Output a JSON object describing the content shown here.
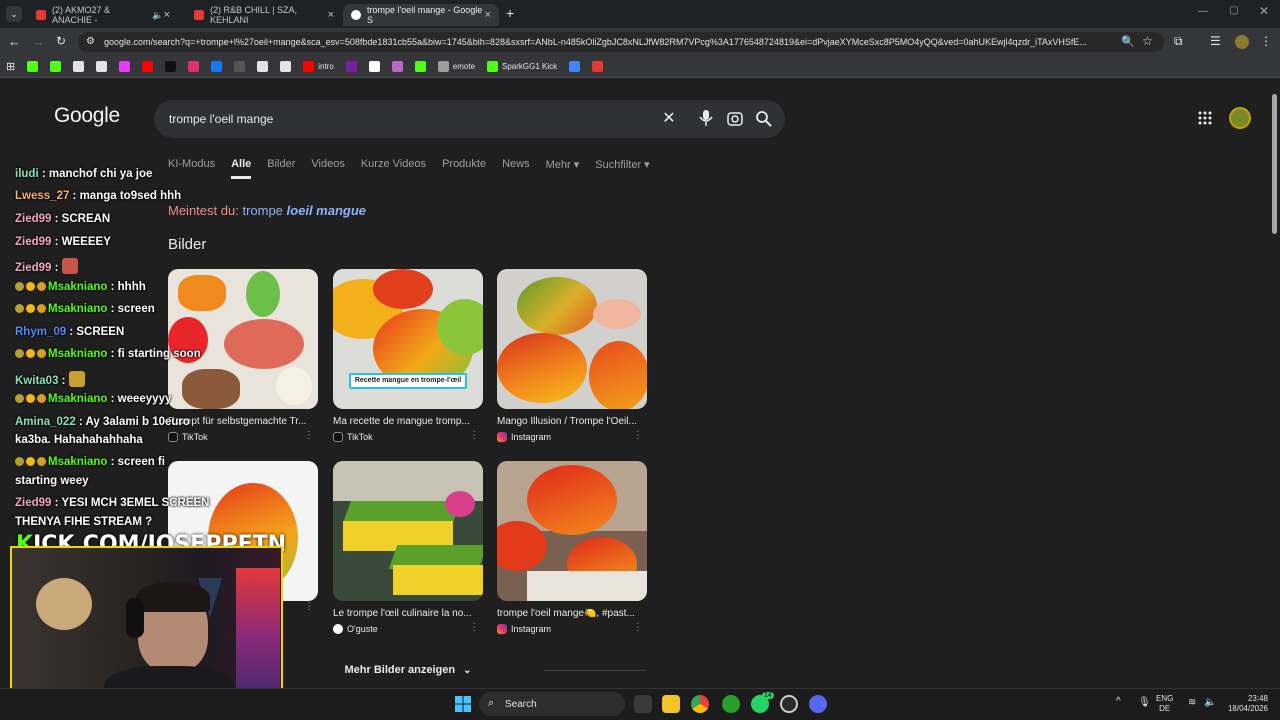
{
  "browser": {
    "tabs": [
      {
        "title": "(2) AKMO27 & ANACHIE - ",
        "active": false,
        "color": "#e53935"
      },
      {
        "title": "(2) R&B CHILL | SZA, KEHLANI",
        "active": false,
        "color": "#e53935"
      },
      {
        "title": "trompe l'oeil mange - Google S",
        "active": true,
        "color": "#8ab4f8"
      }
    ],
    "new_tab": "+",
    "url": "google.com/search?q=+trompe+l%27oeil+mange&sca_esv=508fbde1831cb55a&biw=1745&bih=828&sxsrf=ANbL-n485kOliZgbJC8xNLJfW82RM7VPcg%3A1776548724819&ei=dPvjaeXYMceSxc8P5MO4yQQ&ved=0ahUKEwjl4qzdr_iTAxVHSfE...",
    "bookmarks": [
      {
        "label": "",
        "color": "#53fc18"
      },
      {
        "label": "",
        "color": "#53fc18"
      },
      {
        "label": "",
        "color": "#e3e3e3"
      },
      {
        "label": "",
        "color": "#e3e3e3"
      },
      {
        "label": "",
        "color": "#e040fb"
      },
      {
        "label": "",
        "color": "#ff0000"
      },
      {
        "label": "",
        "color": "#111111"
      },
      {
        "label": "",
        "color": "#e1306c"
      },
      {
        "label": "",
        "color": "#1877f2"
      },
      {
        "label": "",
        "color": "#555555"
      },
      {
        "label": "",
        "color": "#e3e3e3"
      },
      {
        "label": "",
        "color": "#e3e3e3"
      },
      {
        "label": "intro",
        "color": "#ff0000"
      },
      {
        "label": "",
        "color": "#7b1fa2"
      },
      {
        "label": "",
        "color": "#ffffff"
      },
      {
        "label": "",
        "color": "#ba68c8"
      },
      {
        "label": "",
        "color": "#53fc18"
      },
      {
        "label": "emote",
        "color": "#9e9e9e"
      },
      {
        "label": "SparkGG1 Kick",
        "color": "#53fc18"
      },
      {
        "label": "",
        "color": "#4285f4"
      },
      {
        "label": "",
        "color": "#e53935"
      }
    ]
  },
  "google": {
    "logo": "Google",
    "query": "trompe l'oeil mange",
    "tabs": [
      "KI-Modus",
      "Alle",
      "Bilder",
      "Videos",
      "Kurze Videos",
      "Produkte",
      "News",
      "Mehr ▾",
      "Suchfilter ▾"
    ],
    "did_you_mean_prefix": "Meintest du:",
    "did_you_mean_plain": "trompe",
    "did_you_mean_bold": "loeil mangue",
    "images_heading": "Bilder",
    "images": [
      {
        "title": "Rezept für selbstgemachte Tr...",
        "source": "TikTok",
        "source_color": "#111111"
      },
      {
        "title": "Ma recette de mangue tromp...",
        "source": "TikTok",
        "source_color": "#111111",
        "overlay": "Recette mangue en trompe-l'œil"
      },
      {
        "title": "Mango Illusion / Trompe l'Oeil...",
        "source": "Instagram",
        "source_color": "#e1306c"
      },
      {
        "title": "",
        "source": "",
        "source_color": "#111111"
      },
      {
        "title": "Le trompe l'œil culinaire la no...",
        "source": "O'guste",
        "source_color": "#ffffff"
      },
      {
        "title": "trompe l'oeil mange🍋, #past...",
        "source": "Instagram",
        "source_color": "#e1306c"
      }
    ],
    "more_images": "Mehr Bilder anzeigen"
  },
  "chat": [
    {
      "user": "iludi",
      "msg": " : manchof chi ya joe",
      "color": "#8ee0b4"
    },
    {
      "user": "Lwess_27",
      "msg": " : manga to9sed hhh",
      "color": "#f7b267"
    },
    {
      "user": "Zied99",
      "msg": " : SCREAN",
      "color": "#f4a8c0"
    },
    {
      "user": "Zied99",
      "msg": " : WEEEEY",
      "color": "#f4a8c0"
    },
    {
      "user": "Zied99",
      "msg": " : ",
      "color": "#f4a8c0"
    },
    {
      "user": "Msakniano",
      "msg": " : hhhh",
      "color": "#53fc18"
    },
    {
      "user": "Msakniano",
      "msg": " : screen",
      "color": "#53fc18"
    },
    {
      "user": "Rhym_09",
      "msg": " : SCREEN",
      "color": "#4f8ff7"
    },
    {
      "user": "Msakniano",
      "msg": " : fi starting soon",
      "color": "#53fc18"
    },
    {
      "user": "Kwita03",
      "msg": " : ",
      "color": "#8ee0b4"
    },
    {
      "user": "Msakniano",
      "msg": " : weeeyyyy",
      "color": "#53fc18"
    },
    {
      "user": "Amina_022",
      "msg": " : Ay 3alami b 10euro",
      "color": "#8ee0b4"
    },
    {
      "user": "",
      "msg": "ka3ba. Hahahahahhaha",
      "color": "#ffffff"
    },
    {
      "user": "Msakniano",
      "msg": " : screen fi",
      "color": "#53fc18"
    },
    {
      "user": "",
      "msg": "starting weey",
      "color": "#ffffff"
    },
    {
      "user": "Zied99",
      "msg": " : YESI MCH 3EMEL SCREEN",
      "color": "#f4a8c0"
    },
    {
      "user": "",
      "msg": "THENYA FIHE STREAM ?",
      "color": "#ffffff"
    }
  ],
  "overlay": {
    "kick_k": "K",
    "kick_text": "ICK.COM/JOSEPPETN"
  },
  "taskbar": {
    "search_placeholder": "Search",
    "lang_line1": "ENG",
    "lang_line2": "DE",
    "time": "23:48",
    "date": "18/04/2026",
    "whatsapp_badge": "14"
  }
}
